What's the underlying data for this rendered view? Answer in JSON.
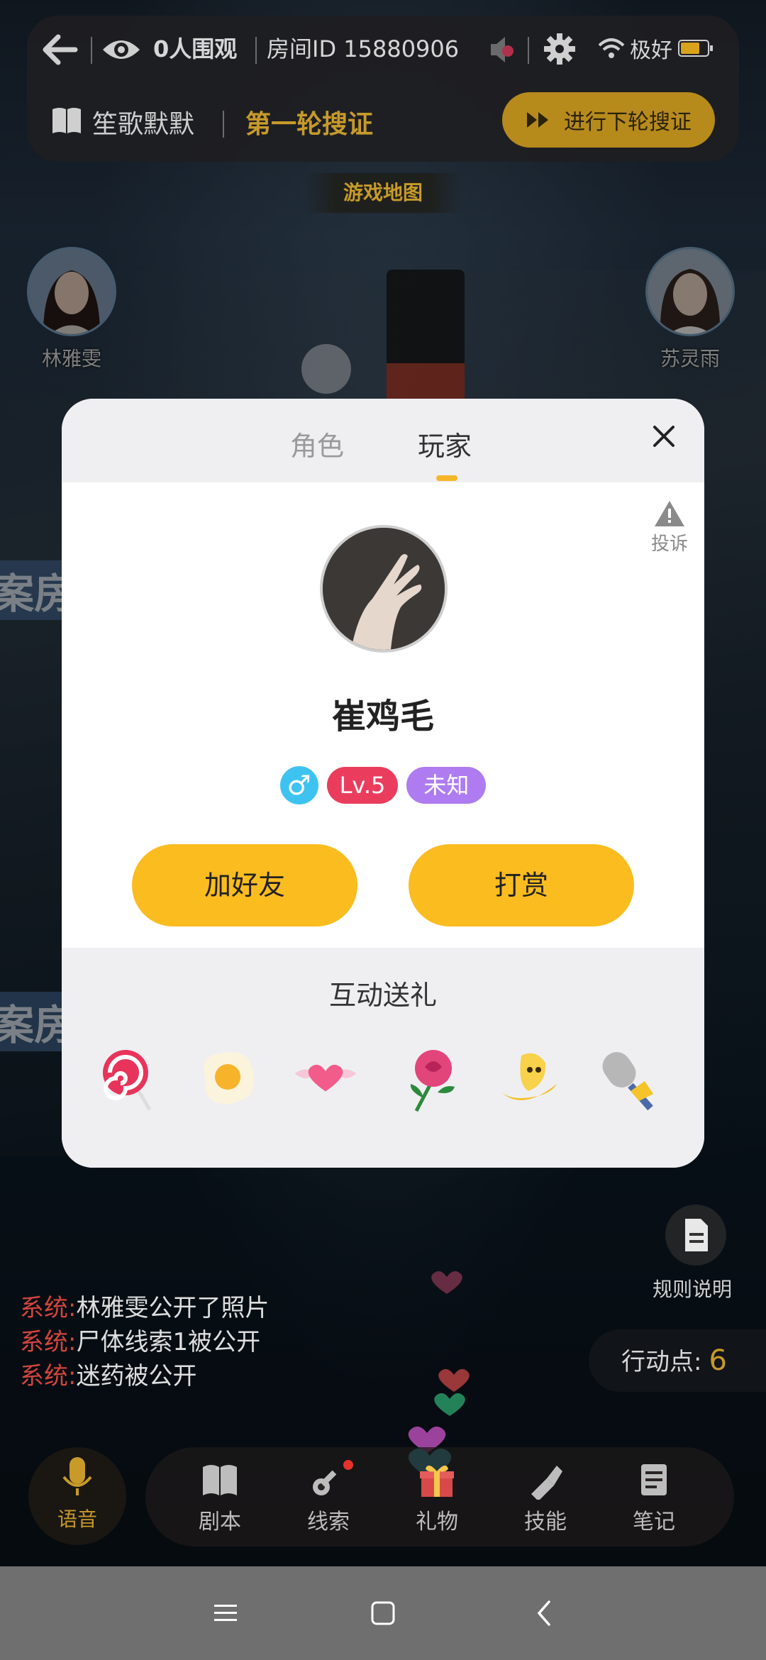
{
  "header": {
    "watchers": "0人围观",
    "room_id": "房间ID 15880906",
    "signal": "极好",
    "script_name": "笙歌默默",
    "phase": "第一轮搜证",
    "next_button": "进行下轮搜证",
    "map_tab": "游戏地图"
  },
  "characters": [
    {
      "name": "林雅雯"
    },
    {
      "name": "苏灵雨"
    }
  ],
  "side_labels": {
    "left_top": "案房",
    "left_bottom": "案房"
  },
  "chat": [
    {
      "prefix": "系统:",
      "text": "林雅雯公开了照片"
    },
    {
      "prefix": "系统:",
      "text": "尸体线索1被公开"
    },
    {
      "prefix": "系统:",
      "text": "迷药被公开"
    }
  ],
  "rules_label": "规则说明",
  "action_points": {
    "label": "行动点:",
    "value": "6"
  },
  "bottom_nav": {
    "voice": "语音",
    "items": [
      {
        "label": "剧本"
      },
      {
        "label": "线索"
      },
      {
        "label": "礼物"
      },
      {
        "label": "技能"
      },
      {
        "label": "笔记"
      }
    ]
  },
  "modal": {
    "tabs": [
      {
        "label": "角色"
      },
      {
        "label": "玩家"
      }
    ],
    "active_tab": "玩家",
    "report_label": "投诉",
    "player_name": "崔鸡毛",
    "gender_symbol": "♂",
    "level": "Lv.5",
    "status": "未知",
    "add_friend": "加好友",
    "tip": "打赏",
    "gift_title": "互动送礼",
    "gifts": [
      "lollipop-icon",
      "fried-egg-icon",
      "winged-heart-icon",
      "rose-icon",
      "banana-icon",
      "microphone-icon"
    ]
  },
  "colors": {
    "accent_yellow": "#fbbc20",
    "gold_text": "#c79a2a",
    "level_badge": "#ea3d5e",
    "status_badge": "#ae7cf0",
    "gender_badge": "#3ec3f0",
    "system_red": "#d2453d"
  }
}
